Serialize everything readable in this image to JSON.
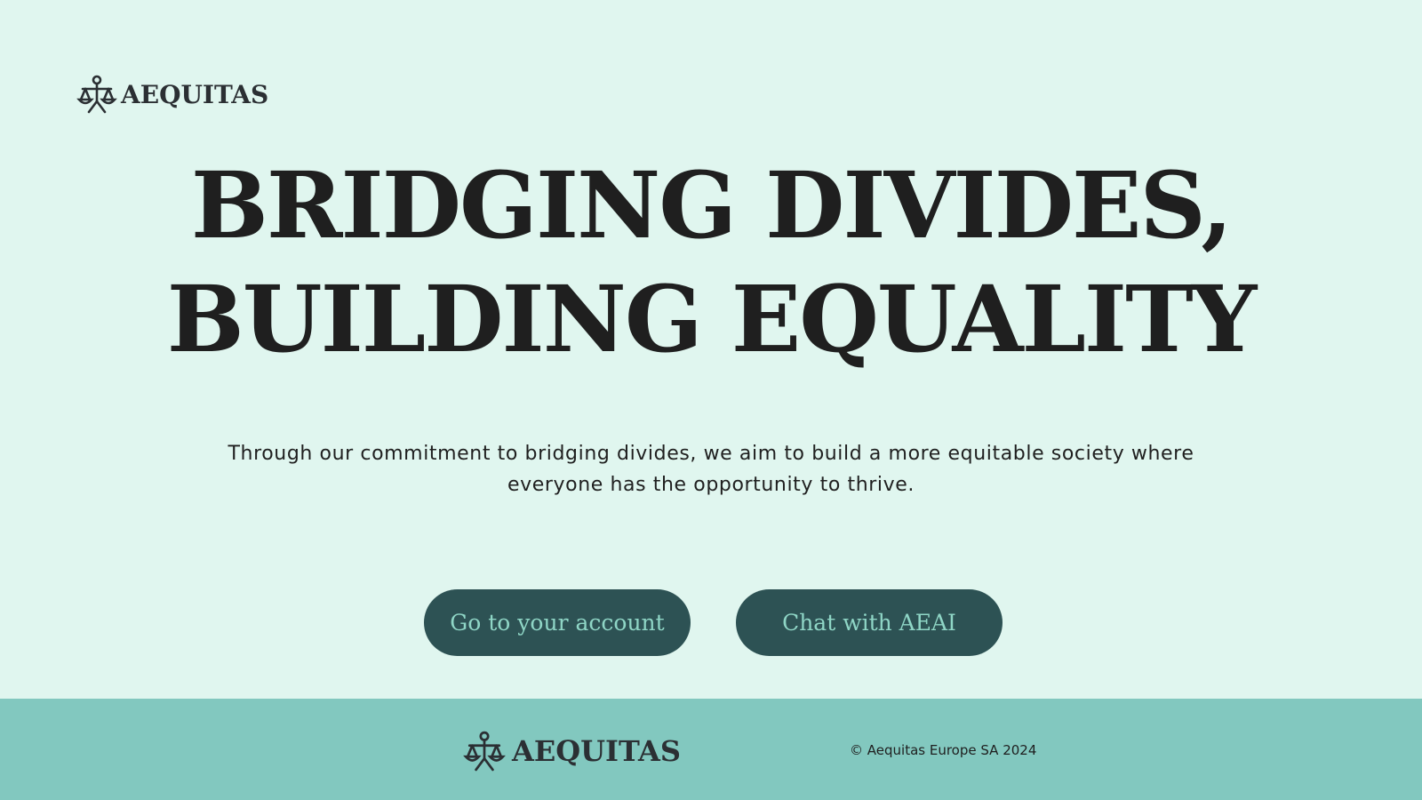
{
  "header": {
    "logo_icon": "scales-of-justice-icon",
    "brand_name": "AEQUITAS"
  },
  "hero": {
    "headline_line1": "BRIDGING DIVIDES,",
    "headline_line2": "BUILDING EQUALITY",
    "tagline_line1": "Through our commitment to bridging divides, we aim to build a more equitable society where",
    "tagline_line2": "everyone has the opportunity to thrive."
  },
  "actions": {
    "account_label": "Go to your account",
    "chat_label": "Chat with AEAI"
  },
  "footer": {
    "logo_icon": "scales-of-justice-icon",
    "brand_name": "AEQUITAS",
    "copyright": "© Aequitas Europe SA 2024"
  },
  "colors": {
    "page_background": "#e0f6ef",
    "footer_background": "#82c8bf",
    "button_background": "#2d5254",
    "button_text": "#8fd6c6",
    "text_dark": "#1f1f1f"
  }
}
